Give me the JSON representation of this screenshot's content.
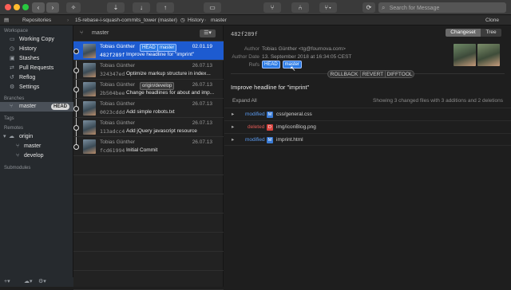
{
  "toolbar": {
    "repo_button": "15-rebase-i-squash-commits_tower (master)",
    "search_placeholder": "Search for Message",
    "traffic_colors": [
      "#fe5f57",
      "#febc2e",
      "#28c840"
    ],
    "icons": [
      "sidebar-toggle-icon",
      "back-icon",
      "forward-icon",
      "magic-wand-icon",
      "fetch-icon",
      "pull-icon",
      "push-icon",
      "commit-icon",
      "stash-icon",
      "branch-icon",
      "merge-icon",
      "git-flow-icon",
      "refresh-icon",
      "search-icon"
    ]
  },
  "pathbar": {
    "repositories": "Repositories",
    "repo": "15-rebase-i-squash-commits_tower",
    "history": "History",
    "branch": "master",
    "clone": "Clone"
  },
  "sidebar": {
    "workspace": "Workspace",
    "items": [
      {
        "label": "Working Copy",
        "icon": "monitor-icon"
      },
      {
        "label": "History",
        "icon": "clock-icon"
      },
      {
        "label": "Stashes",
        "icon": "box-icon"
      },
      {
        "label": "Pull Requests",
        "icon": "pull-request-icon"
      },
      {
        "label": "Reflog",
        "icon": "reflog-icon"
      },
      {
        "label": "Settings",
        "icon": "settings-icon"
      }
    ],
    "branches": "Branches",
    "branch_master": "master",
    "branch_head": "HEAD",
    "tags": "Tags",
    "remotes": "Remotes",
    "remote_origin": "origin",
    "remote_master": "master",
    "remote_develop": "develop",
    "submodules": "Submodules"
  },
  "commits": {
    "header_branch": "master",
    "rows": [
      {
        "author": "Tobias Günther",
        "hash": "482f289f",
        "message": "Improve headline for \"imprint\"",
        "date": "02.01.19",
        "tags": [
          "HEAD",
          "master"
        ]
      },
      {
        "author": "Tobias Günther",
        "hash": "324347ed",
        "message": "Optimize markup structure in index...",
        "date": "26.07.13",
        "tags": []
      },
      {
        "author": "Tobias Günther",
        "hash": "2b504bee",
        "message": "Change headlines for about and imp...",
        "date": "26.07.13",
        "tags": [
          "origin/develop"
        ]
      },
      {
        "author": "Tobias Günther",
        "hash": "0023cddd",
        "message": "Add simple robots.txt",
        "date": "26.07.13",
        "tags": []
      },
      {
        "author": "Tobias Günther",
        "hash": "113adcc4",
        "message": "Add jQuery javascript resource",
        "date": "26.07.13",
        "tags": []
      },
      {
        "author": "Tobias Günther",
        "hash": "fcd61994",
        "message": "Initial Commit",
        "date": "26.07.13",
        "tags": []
      }
    ]
  },
  "detail": {
    "hash": "482f289f",
    "tab_changeset": "Changeset",
    "tab_tree": "Tree",
    "author_label": "Author",
    "author_value": "Tobias Günther <tg@fournova.com>",
    "date_label": "Author Date",
    "date_value": "13. September 2018 at 16:34:05 CEST",
    "refs_label": "Refs",
    "ref_head": "HEAD",
    "ref_master": "master",
    "rollback": "ROLLBACK",
    "revert": "REVERT",
    "difftool": "DIFFTOOL",
    "subject": "Improve headline for \"imprint\"",
    "expand_all": "Expand All",
    "summary": "Showing 3 changed files with 3 additions and 2 deletions",
    "files": [
      {
        "status": "modified",
        "badge": "M",
        "name": "css/general.css",
        "color": "#3a7bd5"
      },
      {
        "status": "deleted",
        "badge": "D",
        "name": "img/iconBlog.png",
        "color": "#d9443f"
      },
      {
        "status": "modified",
        "badge": "M",
        "name": "imprint.html",
        "color": "#3a7bd5"
      }
    ]
  },
  "colors": {
    "selection": "#1d5bd0",
    "head_tag": "#2c7be5",
    "modified": "#5b9bf0",
    "deleted": "#e05a55"
  }
}
